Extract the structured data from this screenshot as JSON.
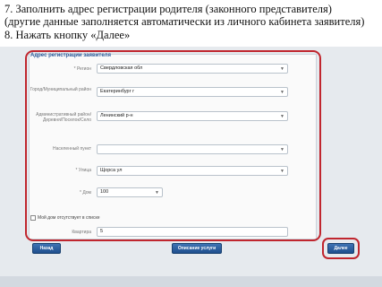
{
  "instructions": [
    "7. Заполнить адрес регистрации родителя (законного представителя)",
    "(другие данные заполняется автоматически из личного кабинета заявителя)",
    "8. Нажать кнопку «Далее»"
  ],
  "form": {
    "title": "Адрес регистрации заявителя",
    "fields": [
      {
        "label": "* Регион",
        "value": "Свердловская обл"
      },
      {
        "label": "Город/Муниципальный район",
        "value": "Екатеринбург г"
      },
      {
        "label": "Административный район/Деревня/Поселок/Село",
        "value": "Ленинский р-н"
      },
      {
        "label": "Населенный пункт",
        "value": ""
      },
      {
        "label": "* Улица",
        "value": "Щорса ул"
      },
      {
        "label": "* Дом",
        "value": "100"
      }
    ],
    "checkbox_label": "Мой дом отсутствует в списке",
    "apartment": {
      "label": "Квартира",
      "value": "5"
    }
  },
  "buttons": {
    "back": "Назад",
    "description": "Описание услуги",
    "next": "Далее"
  },
  "colors": {
    "highlight": "#c0262e",
    "button": "#2a5d9f"
  }
}
